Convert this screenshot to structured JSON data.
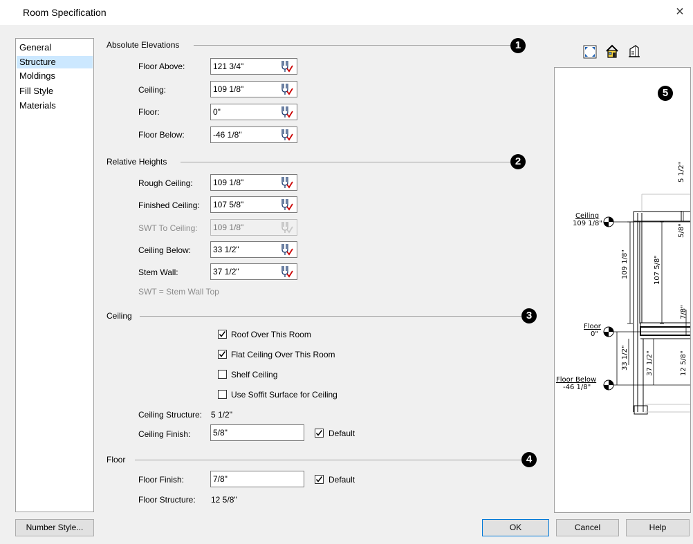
{
  "window": {
    "title": "Room Specification",
    "close_glyph": "×"
  },
  "nav": {
    "items": [
      "General",
      "Structure",
      "Moldings",
      "Fill Style",
      "Materials"
    ],
    "selected": "Structure"
  },
  "absolute": {
    "header": "Absolute Elevations",
    "callout": "1",
    "floor_above": {
      "label": "Floor Above:",
      "value": "121 3/4\""
    },
    "ceiling": {
      "label": "Ceiling:",
      "value": "109 1/8\""
    },
    "floor": {
      "label": "Floor:",
      "value": "0\""
    },
    "floor_below": {
      "label": "Floor Below:",
      "value": "-46 1/8\""
    }
  },
  "relative": {
    "header": "Relative Heights",
    "callout": "2",
    "rough_ceiling": {
      "label": "Rough Ceiling:",
      "value": "109 1/8\""
    },
    "finished_ceiling": {
      "label": "Finished Ceiling:",
      "value": "107 5/8\""
    },
    "swt_to_ceiling": {
      "label": "SWT To Ceiling:",
      "value": "109 1/8\""
    },
    "ceiling_below": {
      "label": "Ceiling Below:",
      "value": "33 1/2\""
    },
    "stem_wall": {
      "label": "Stem Wall:",
      "value": "37 1/2\""
    },
    "note": "SWT = Stem Wall Top"
  },
  "ceiling": {
    "header": "Ceiling",
    "callout": "3",
    "roof_over": {
      "label": "Roof Over This Room",
      "checked": true
    },
    "flat_ceiling": {
      "label": "Flat Ceiling Over This Room",
      "checked": true
    },
    "shelf_ceiling": {
      "label": "Shelf Ceiling",
      "checked": false
    },
    "soffit": {
      "label": "Use Soffit Surface for Ceiling",
      "checked": false
    },
    "structure_label": "Ceiling Structure:",
    "structure_value": "5 1/2\"",
    "finish_label": "Ceiling Finish:",
    "finish_value": "5/8\"",
    "default_label": "Default",
    "default_checked": true
  },
  "floor": {
    "header": "Floor",
    "callout": "4",
    "finish_label": "Floor Finish:",
    "finish_value": "7/8\"",
    "default_label": "Default",
    "default_checked": true,
    "structure_label": "Floor Structure:",
    "structure_value": "12 5/8\""
  },
  "preview": {
    "callout": "5",
    "toolbar_icons": [
      "fill-window-icon",
      "house-3d-icon",
      "elevation-view-icon"
    ],
    "ceiling_label": "Ceiling",
    "ceiling_value": "109 1/8\"",
    "floor_label": "Floor",
    "floor_value": "0\"",
    "floor_below_label": "Floor Below",
    "floor_below_value": "-46 1/8\"",
    "dim_5_1_2": "5 1/2\"",
    "dim_5_8": "5/8\"",
    "dim_109_1_8": "109 1/8\"",
    "dim_107_5_8": "107 5/8\"",
    "dim_7_8": "7/8\"",
    "dim_33_1_2": "33 1/2\"",
    "dim_37_1_2": "37 1/2\"",
    "dim_12_5_8": "12 5/8\""
  },
  "buttons": {
    "number_style": "Number Style...",
    "ok": "OK",
    "cancel": "Cancel",
    "help": "Help"
  },
  "colors": {
    "accent": "#0078d7",
    "check_red": "#cc0000",
    "selection": "#cce8ff"
  }
}
